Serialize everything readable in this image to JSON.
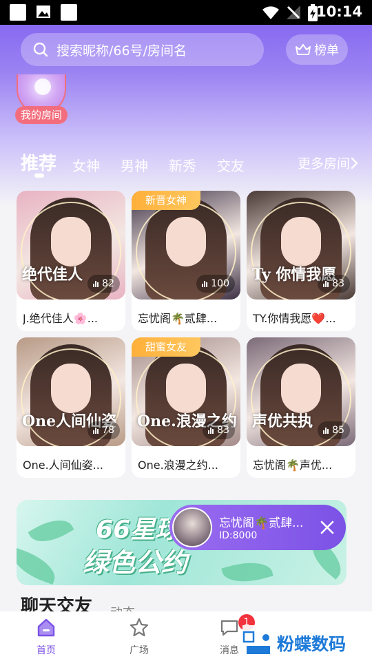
{
  "status_bar": {
    "time": "10:14"
  },
  "search": {
    "placeholder": "搜索昵称/66号/房间名",
    "rank_label": "榜单"
  },
  "my_room": {
    "label": "我的房间"
  },
  "tabs": {
    "items": [
      {
        "label": "推荐",
        "active": true
      },
      {
        "label": "女神"
      },
      {
        "label": "男神"
      },
      {
        "label": "新秀"
      },
      {
        "label": "交友"
      }
    ],
    "more": "更多房间"
  },
  "rooms": [
    {
      "title": "J.绝代佳人🌸...",
      "count": "82",
      "badge": "",
      "sign": "绝代佳人",
      "palette": "#e8b3c3"
    },
    {
      "title": "忘忧阁🌴贰肆...",
      "count": "100",
      "badge": "新晋女神",
      "sign": "",
      "palette": "#3b2f44"
    },
    {
      "title": "TY.你情我愿❤️...",
      "count": "83",
      "badge": "",
      "sign": "Ty 你情我愿",
      "palette": "#4a3a36"
    },
    {
      "title": "One.人间仙姿...",
      "count": "78",
      "badge": "",
      "sign": "One人间仙姿",
      "palette": "#b89a86"
    },
    {
      "title": "One.浪漫之约...",
      "count": "83",
      "badge": "甜蜜女友",
      "sign": "One.浪漫之约",
      "palette": "#a38b88"
    },
    {
      "title": "忘忧阁🌴声优...",
      "count": "85",
      "badge": "",
      "sign": "声优共执",
      "palette": "#7b6a78"
    }
  ],
  "banner": {
    "line1": "66星球",
    "line2": "绿色公约"
  },
  "mini_player": {
    "title": "忘忧阁🌴贰肆...",
    "id": "ID:8000"
  },
  "section": {
    "title": "聊天交友",
    "sub": "动态"
  },
  "nav": {
    "items": [
      {
        "label": "首页",
        "icon": "home-icon",
        "active": true
      },
      {
        "label": "广场",
        "icon": "star-icon"
      },
      {
        "label": "消息",
        "icon": "message-icon",
        "badge": "1"
      }
    ]
  },
  "watermark": {
    "text": "粉蝶数码"
  },
  "colors": {
    "accent": "#7b52e6",
    "badge_orange": "#ffb03a",
    "badge_red": "#f2323d"
  }
}
